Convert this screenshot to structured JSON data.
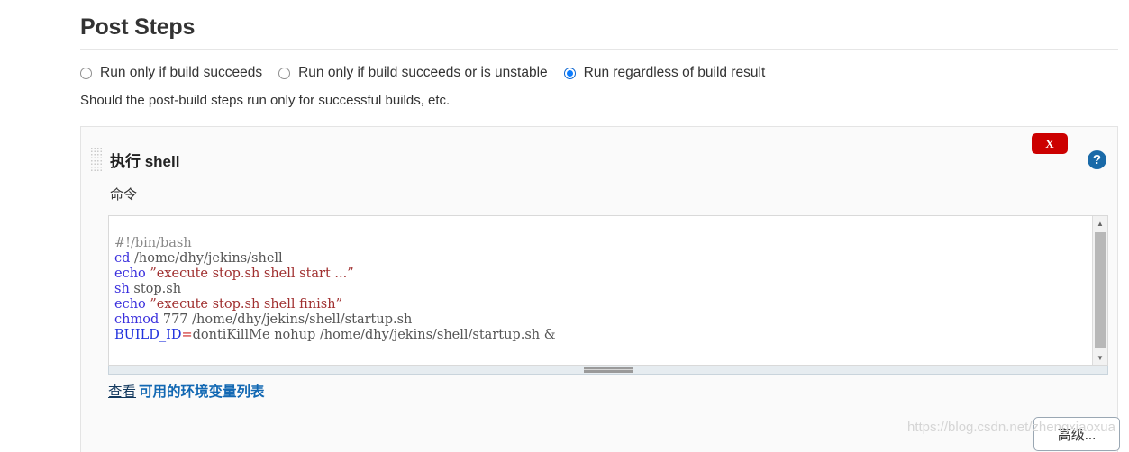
{
  "page": {
    "title": "Post Steps",
    "helper_text": "Should the post-build steps run only for successful builds, etc.",
    "watermark": "https://blog.csdn.net/zhengxiaoxua"
  },
  "run_condition": {
    "options": [
      {
        "label": "Run only if build succeeds",
        "selected": false
      },
      {
        "label": "Run only if build succeeds or is unstable",
        "selected": false
      },
      {
        "label": "Run regardless of build result",
        "selected": true
      }
    ]
  },
  "builder": {
    "heading": "执行 shell",
    "delete_label": "X",
    "help_label": "?",
    "command_label": "命令",
    "advanced_label": "高级...",
    "env_prefix": "查看",
    "env_link": "可用的环境变量列表",
    "scroll_up_glyph": "▲",
    "scroll_down_glyph": "▼",
    "command_script": [
      "#!/bin/bash",
      "cd /home/dhy/jekins/shell",
      "echo ”execute stop.sh shell start ...”",
      "sh stop.sh",
      "echo ”execute stop.sh shell finish”",
      "chmod 777 /home/dhy/jekins/shell/startup.sh",
      "BUILD_ID=dontiKillMe nohup /home/dhy/jekins/shell/startup.sh &"
    ],
    "command_tokens": [
      [
        {
          "t": "#!/bin/bash",
          "c": "tok-gray"
        }
      ],
      [
        {
          "t": "cd",
          "c": "tok-kw"
        },
        {
          "t": " /home/dhy/jekins/shell",
          "c": "tok-plain"
        }
      ],
      [
        {
          "t": "echo",
          "c": "tok-kw"
        },
        {
          "t": " ",
          "c": "tok-plain"
        },
        {
          "t": "”execute stop.sh shell start ...”",
          "c": "tok-str"
        }
      ],
      [
        {
          "t": "sh",
          "c": "tok-kw"
        },
        {
          "t": " stop.sh",
          "c": "tok-plain"
        }
      ],
      [
        {
          "t": "echo",
          "c": "tok-kw"
        },
        {
          "t": " ",
          "c": "tok-plain"
        },
        {
          "t": "”execute stop.sh shell finish”",
          "c": "tok-str"
        }
      ],
      [
        {
          "t": "chmod",
          "c": "tok-kw"
        },
        {
          "t": " 777 /home/dhy/jekins/shell/startup.sh",
          "c": "tok-plain"
        }
      ],
      [
        {
          "t": "BUILD_ID",
          "c": "tok-var"
        },
        {
          "t": "=",
          "c": "tok-op"
        },
        {
          "t": "dontiKillMe nohup /home/dhy/jekins/shell/startup.sh &",
          "c": "tok-plain"
        }
      ]
    ]
  },
  "colors": {
    "accent_blue": "#0a7cff",
    "delete_red": "#cc0000",
    "help_blue": "#1a6aa8",
    "link_blue": "#1268b3",
    "panel_bg": "#fafafa"
  }
}
